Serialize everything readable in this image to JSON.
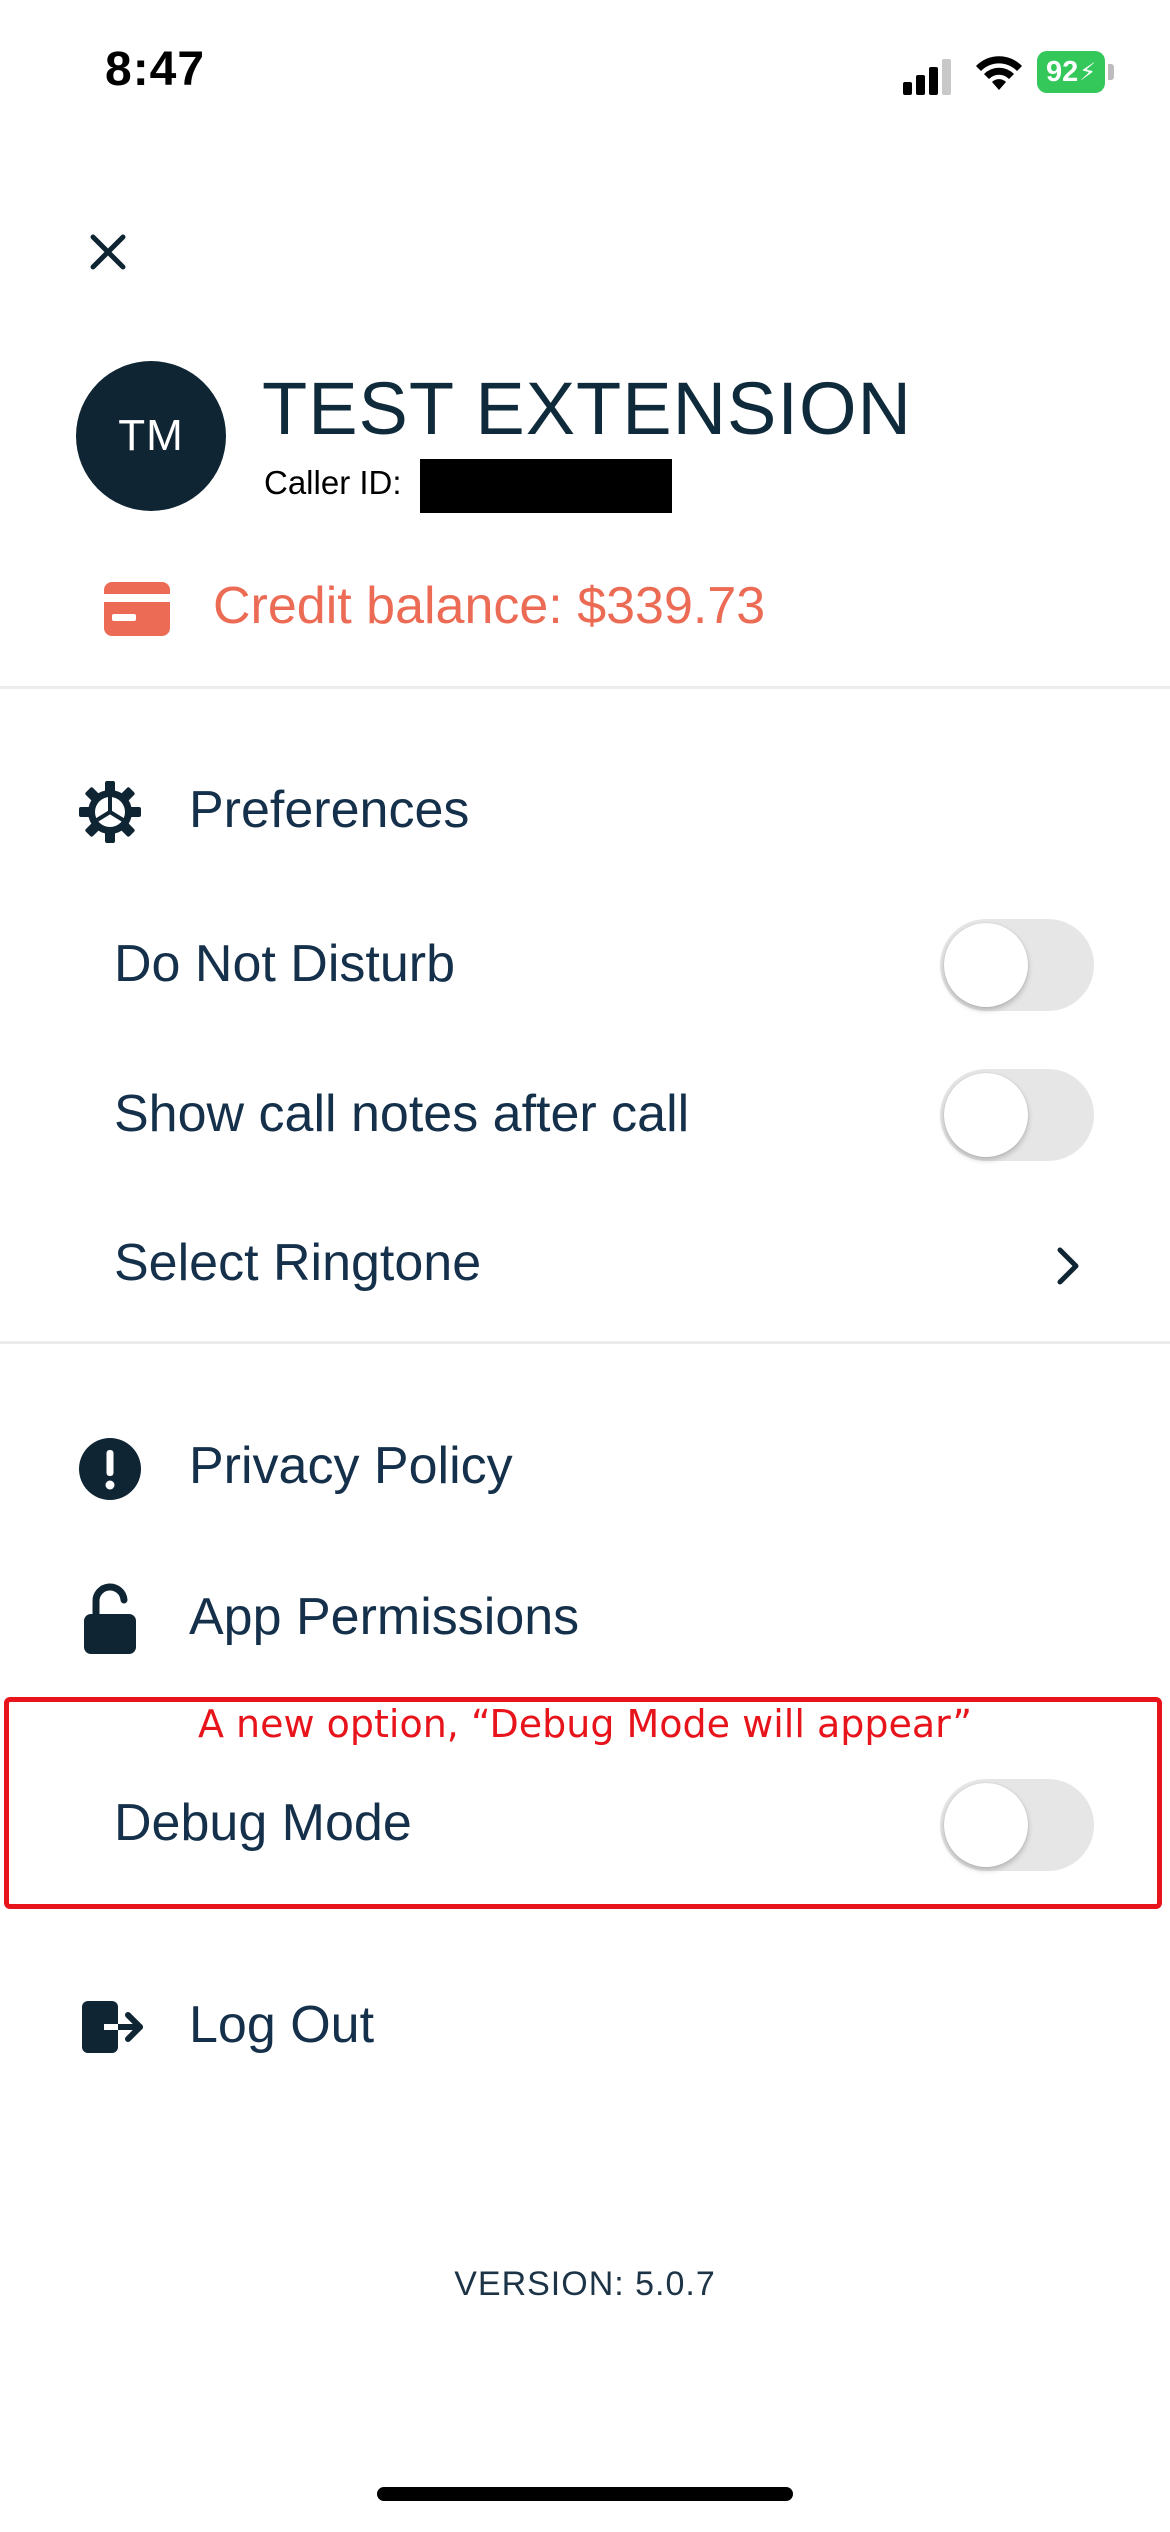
{
  "status_bar": {
    "time": "8:47",
    "battery": "92"
  },
  "profile": {
    "initials": "TM",
    "name": "TEST EXTENSION",
    "caller_id_label": "Caller ID:",
    "credit_balance": "Credit balance: $339.73"
  },
  "preferences": {
    "title": "Preferences",
    "do_not_disturb": {
      "label": "Do Not Disturb",
      "enabled": false
    },
    "show_call_notes": {
      "label": "Show call notes after call",
      "enabled": false
    },
    "select_ringtone": {
      "label": "Select Ringtone"
    }
  },
  "menu": {
    "privacy_policy": "Privacy Policy",
    "app_permissions": "App Permissions",
    "log_out": "Log Out"
  },
  "debug": {
    "annotation": "A new option, “Debug Mode will appear”",
    "label": "Debug Mode",
    "enabled": false
  },
  "footer": {
    "version": "VERSION: 5.0.7"
  },
  "colors": {
    "primary": "#0f2533",
    "accent": "#ec6b55",
    "annotation": "#e8141b",
    "toggle_off": "#e6e6e6"
  },
  "icons": {
    "close": "close-icon",
    "credit": "credit-card-icon",
    "preferences": "gear-icon",
    "privacy": "exclamation-circle-icon",
    "permissions": "unlocked-padlock-icon",
    "logout": "logout-icon",
    "ringtone_chevron": "chevron-right-icon"
  }
}
